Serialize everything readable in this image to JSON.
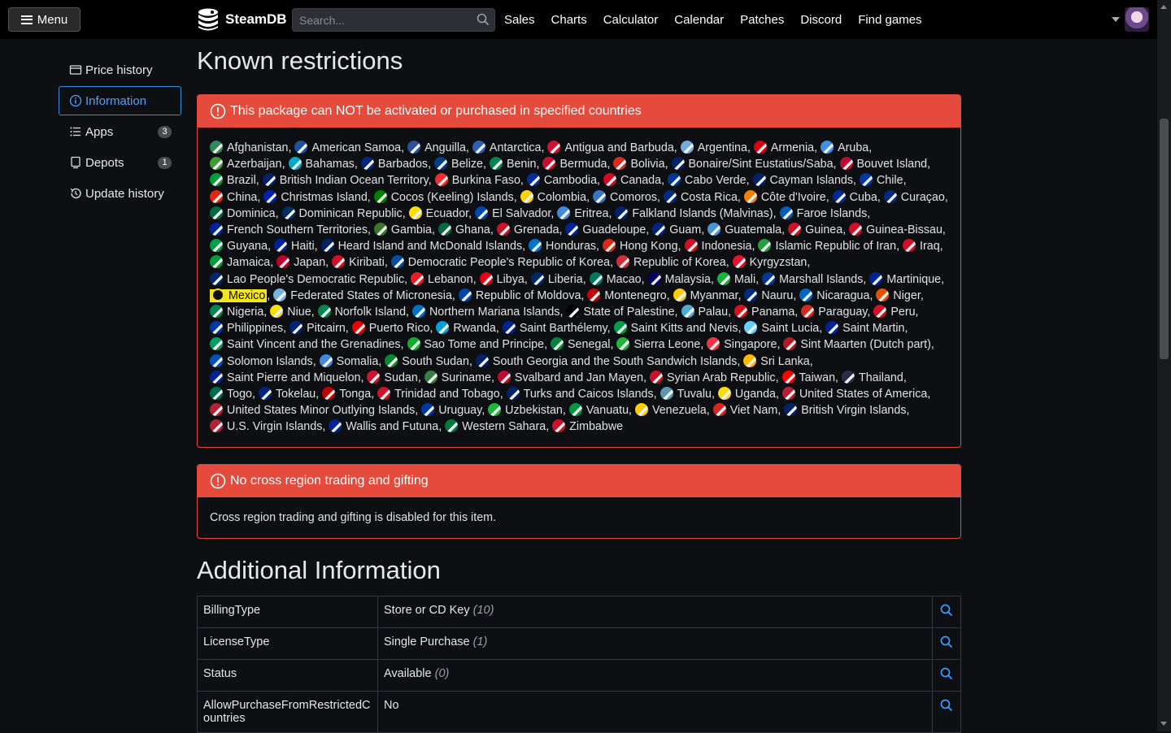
{
  "topnav": {
    "menu_label": "Menu",
    "brand": "SteamDB",
    "search_placeholder": "Search...",
    "links": [
      "Sales",
      "Charts",
      "Calculator",
      "Calendar",
      "Patches",
      "Discord",
      "Find games"
    ]
  },
  "sidebar": {
    "items": [
      {
        "label": "Price history",
        "icon": "price-history-icon",
        "active": false,
        "badge": ""
      },
      {
        "label": "Information",
        "icon": "info-icon",
        "active": true,
        "badge": ""
      },
      {
        "label": "Apps",
        "icon": "list-icon",
        "active": false,
        "badge": "3"
      },
      {
        "label": "Depots",
        "icon": "depot-icon",
        "active": false,
        "badge": "1"
      },
      {
        "label": "Update history",
        "icon": "history-icon",
        "active": false,
        "badge": ""
      }
    ]
  },
  "main": {
    "restrictions_title": "Known restrictions",
    "country_alert": {
      "title": "This package can NOT be activated or purchased in specified countries",
      "highlighted": "Mexico",
      "countries": [
        "Afghanistan",
        "American Samoa",
        "Anguilla",
        "Antarctica",
        "Antigua and Barbuda",
        "Argentina",
        "Armenia",
        "Aruba",
        "Azerbaijan",
        "Bahamas",
        "Barbados",
        "Belize",
        "Benin",
        "Bermuda",
        "Bolivia",
        "Bonaire/Sint Eustatius/Saba",
        "Bouvet Island",
        "Brazil",
        "British Indian Ocean Territory",
        "Burkina Faso",
        "Cambodia",
        "Canada",
        "Cabo Verde",
        "Cayman Islands",
        "Chile",
        "China",
        "Christmas Island",
        "Cocos (Keeling) Islands",
        "Colombia",
        "Comoros",
        "Costa Rica",
        "Côte d'Ivoire",
        "Cuba",
        "Curaçao",
        "Dominica",
        "Dominican Republic",
        "Ecuador",
        "El Salvador",
        "Eritrea",
        "Falkland Islands (Malvinas)",
        "Faroe Islands",
        "French Southern Territories",
        "Gambia",
        "Ghana",
        "Grenada",
        "Guadeloupe",
        "Guam",
        "Guatemala",
        "Guinea",
        "Guinea-Bissau",
        "Guyana",
        "Haiti",
        "Heard Island and McDonald Islands",
        "Honduras",
        "Hong Kong",
        "Indonesia",
        "Islamic Republic of Iran",
        "Iraq",
        "Jamaica",
        "Japan",
        "Kiribati",
        "Democratic People's Republic of Korea",
        "Republic of Korea",
        "Kyrgyzstan",
        "Lao People's Democratic Republic",
        "Lebanon",
        "Libya",
        "Liberia",
        "Macao",
        "Malaysia",
        "Mali",
        "Marshall Islands",
        "Martinique",
        "Mexico",
        "Federated States of Micronesia",
        "Republic of Moldova",
        "Montenegro",
        "Myanmar",
        "Nauru",
        "Nicaragua",
        "Niger",
        "Nigeria",
        "Niue",
        "Norfolk Island",
        "Northern Mariana Islands",
        "State of Palestine",
        "Palau",
        "Panama",
        "Paraguay",
        "Peru",
        "Philippines",
        "Pitcairn",
        "Puerto Rico",
        "Rwanda",
        "Saint Barthélemy",
        "Saint Kitts and Nevis",
        "Saint Lucia",
        "Saint Martin",
        "Saint Vincent and the Grenadines",
        "Sao Tome and Principe",
        "Senegal",
        "Sierra Leone",
        "Singapore",
        "Sint Maarten (Dutch part)",
        "Solomon Islands",
        "Somalia",
        "South Sudan",
        "South Georgia and the South Sandwich Islands",
        "Sri Lanka",
        "Saint Pierre and Miquelon",
        "Sudan",
        "Suriname",
        "Svalbard and Jan Mayen",
        "Syrian Arab Republic",
        "Taiwan",
        "Thailand",
        "Togo",
        "Tokelau",
        "Tonga",
        "Trinidad and Tobago",
        "Turks and Caicos Islands",
        "Tuvalu",
        "Uganda",
        "United States of America",
        "United States Minor Outlying Islands",
        "Uruguay",
        "Uzbekistan",
        "Vanuatu",
        "Venezuela",
        "Viet Nam",
        "British Virgin Islands",
        "U.S. Virgin Islands",
        "Wallis and Futuna",
        "Western Sahara",
        "Zimbabwe"
      ],
      "flag_colors": [
        "#2e8b57",
        "#1e4fa1",
        "#2a4f9c",
        "#2d5fb6",
        "#d21034",
        "#74acdf",
        "#d90012",
        "#418fde",
        "#3f9c35",
        "#00abc9",
        "#00267f",
        "#003f87",
        "#008751",
        "#c8102e",
        "#d52b1e",
        "#012169",
        "#ba0c2f",
        "#009c3b",
        "#012169",
        "#ef2b2d",
        "#032ea1",
        "#d80621",
        "#003893",
        "#012169",
        "#0039a6",
        "#de2910",
        "#0021ad",
        "#008000",
        "#fcd116",
        "#3a75c4",
        "#002b7f",
        "#f77f00",
        "#002a8f",
        "#002b7f",
        "#006b3f",
        "#002d62",
        "#ffdd00",
        "#0047ab",
        "#4189dd",
        "#012169",
        "#005eb8",
        "#002395",
        "#3a7728",
        "#006b3f",
        "#ce1126",
        "#002395",
        "#00247d",
        "#4997d0",
        "#ce1126",
        "#ce1126",
        "#009e49",
        "#00209f",
        "#012169",
        "#0073cf",
        "#de2910",
        "#ce1126",
        "#239f40",
        "#ce1126",
        "#009b3a",
        "#bc002d",
        "#ce1126",
        "#024fa2",
        "#cd2e3a",
        "#e8112d",
        "#002868",
        "#ed1c24",
        "#e70013",
        "#002868",
        "#00785e",
        "#010066",
        "#14b53a",
        "#003893",
        "#002395",
        "#006847",
        "#75b2dd",
        "#0046ae",
        "#c40308",
        "#fecb00",
        "#002b7f",
        "#0067c6",
        "#e05206",
        "#008751",
        "#fedd00",
        "#008751",
        "#0071bc",
        "#000000",
        "#4aadd6",
        "#da121a",
        "#d52b1e",
        "#d91023",
        "#0038a8",
        "#00247d",
        "#ed0000",
        "#00a1de",
        "#002395",
        "#009e49",
        "#65cfff",
        "#002395",
        "#009e60",
        "#12ad2b",
        "#00853f",
        "#1eb53a",
        "#ef3340",
        "#ae1c28",
        "#0051ba",
        "#4189dd",
        "#078930",
        "#012169",
        "#ffb700",
        "#002395",
        "#d21034",
        "#377e3f",
        "#ba0c2f",
        "#ce1126",
        "#fe0000",
        "#2d2a4a",
        "#006a4e",
        "#00247d",
        "#c10000",
        "#ce1126",
        "#012169",
        "#5b97b1",
        "#fcdc04",
        "#b22234",
        "#b22234",
        "#0038a8",
        "#1eb53a",
        "#009543",
        "#ffcc00",
        "#da251d",
        "#012169",
        "#b22234",
        "#002395",
        "#007a3d",
        "#ce1126"
      ]
    },
    "trading_alert": {
      "title": "No cross region trading and gifting",
      "body": "Cross region trading and gifting is disabled for this item."
    },
    "additional_title": "Additional Information",
    "info_rows": [
      {
        "key": "BillingType",
        "value": "Store or CD Key",
        "code": "(10)"
      },
      {
        "key": "LicenseType",
        "value": "Single Purchase",
        "code": "(1)"
      },
      {
        "key": "Status",
        "value": "Available",
        "code": "(0)"
      },
      {
        "key": "AllowPurchaseFromRestrictedCountries",
        "value": "No",
        "code": ""
      }
    ]
  },
  "colors": {
    "alert_red": "#e54b3c",
    "accent_blue": "#4da3ff",
    "highlight_yellow": "#f3e51c"
  }
}
